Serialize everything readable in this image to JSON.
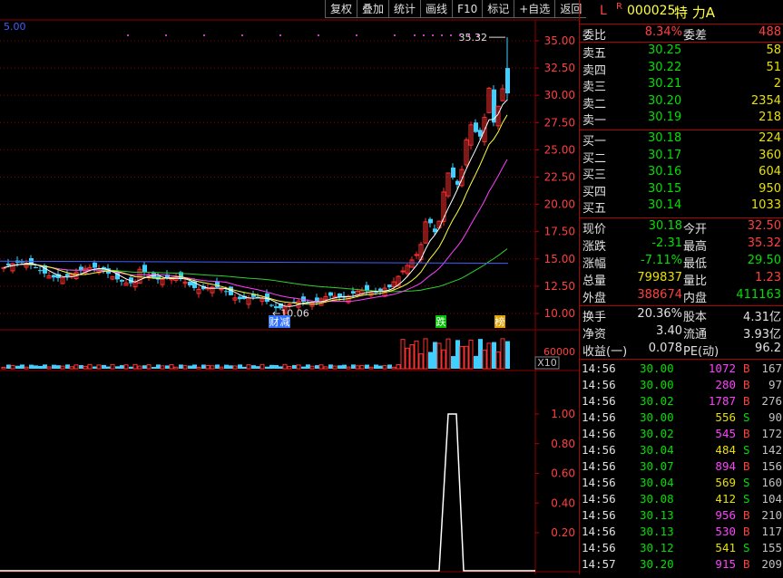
{
  "toolbar": [
    "复权",
    "叠加",
    "统计",
    "画线",
    "F10",
    "标记",
    "+自选",
    "返回"
  ],
  "chart": {
    "ma_label": "5.00",
    "peak_label": "35.32",
    "low_label": "10.06",
    "price_ticks": [
      "35.00",
      "32.50",
      "30.00",
      "27.50",
      "25.00",
      "22.50",
      "20.00",
      "17.50",
      "15.00",
      "12.50",
      "10.00"
    ],
    "badges": [
      {
        "text": "财",
        "color": "#3070ff"
      },
      {
        "text": "减",
        "color": "#3070ff"
      },
      {
        "text": "跌",
        "color": "#00c000"
      },
      {
        "text": "榜",
        "color": "#e0a000"
      }
    ],
    "vol_tick": "60000",
    "vol_unit": "X10",
    "ind_ticks": [
      "1.00",
      "0.80",
      "0.60",
      "0.40",
      "0.20"
    ],
    "colors": {
      "up": "#ff3030",
      "down": "#40d0ff",
      "ma5": "#ffffff",
      "ma10": "#ffff40",
      "ma20": "#ff40ff",
      "ma60": "#30d030",
      "grid": "#8b0000"
    }
  },
  "quote": {
    "header_l": "L",
    "header_r": "R",
    "code": "000025",
    "name": "特 力A",
    "weibi_label": "委比",
    "weibi": "8.34%",
    "weicha_label": "委差",
    "weicha": "488",
    "asks": [
      {
        "label": "卖五",
        "price": "30.25",
        "vol": "58"
      },
      {
        "label": "卖四",
        "price": "30.22",
        "vol": "51"
      },
      {
        "label": "卖三",
        "price": "30.21",
        "vol": "2"
      },
      {
        "label": "卖二",
        "price": "30.20",
        "vol": "2354"
      },
      {
        "label": "卖一",
        "price": "30.19",
        "vol": "218"
      }
    ],
    "bids": [
      {
        "label": "买一",
        "price": "30.18",
        "vol": "224"
      },
      {
        "label": "买二",
        "price": "30.17",
        "vol": "360"
      },
      {
        "label": "买三",
        "price": "30.16",
        "vol": "604"
      },
      {
        "label": "买四",
        "price": "30.15",
        "vol": "950"
      },
      {
        "label": "买五",
        "price": "30.14",
        "vol": "1033"
      }
    ],
    "stats": [
      {
        "l1": "现价",
        "v1": "30.18",
        "c1": "g",
        "l2": "今开",
        "v2": "32.50",
        "c2": "r"
      },
      {
        "l1": "涨跌",
        "v1": "-2.31",
        "c1": "g",
        "l2": "最高",
        "v2": "35.32",
        "c2": "r"
      },
      {
        "l1": "涨幅",
        "v1": "-7.11%",
        "c1": "g",
        "l2": "最低",
        "v2": "29.50",
        "c2": "g"
      },
      {
        "l1": "总量",
        "v1": "799837",
        "c1": "y",
        "l2": "量比",
        "v2": "1.23",
        "c2": "r"
      },
      {
        "l1": "外盘",
        "v1": "388674",
        "c1": "r",
        "l2": "内盘",
        "v2": "411163",
        "c2": "g"
      }
    ],
    "fund": [
      {
        "l1": "换手",
        "v1": "20.36%",
        "l2": "股本",
        "v2": "4.31亿"
      },
      {
        "l1": "净资",
        "v1": "3.40",
        "l2": "流通",
        "v2": "3.93亿"
      },
      {
        "l1": "收益(一)",
        "v1": "0.078",
        "l2": "PE(动)",
        "v2": "96.2"
      }
    ],
    "ticks": [
      {
        "time": "14:56",
        "price": "30.00",
        "vol": "1072",
        "dir": "B",
        "cnt": "167"
      },
      {
        "time": "14:56",
        "price": "30.00",
        "vol": "280",
        "dir": "B",
        "cnt": "97"
      },
      {
        "time": "14:56",
        "price": "30.02",
        "vol": "1787",
        "dir": "B",
        "cnt": "276"
      },
      {
        "time": "14:56",
        "price": "30.00",
        "vol": "556",
        "dir": "S",
        "cnt": "90"
      },
      {
        "time": "14:56",
        "price": "30.02",
        "vol": "545",
        "dir": "B",
        "cnt": "172"
      },
      {
        "time": "14:56",
        "price": "30.04",
        "vol": "484",
        "dir": "S",
        "cnt": "142"
      },
      {
        "time": "14:56",
        "price": "30.07",
        "vol": "894",
        "dir": "B",
        "cnt": "156"
      },
      {
        "time": "14:56",
        "price": "30.04",
        "vol": "569",
        "dir": "S",
        "cnt": "160"
      },
      {
        "time": "14:56",
        "price": "30.08",
        "vol": "412",
        "dir": "S",
        "cnt": "104"
      },
      {
        "time": "14:56",
        "price": "30.13",
        "vol": "956",
        "dir": "B",
        "cnt": "210"
      },
      {
        "time": "14:56",
        "price": "30.13",
        "vol": "530",
        "dir": "B",
        "cnt": "117"
      },
      {
        "time": "14:56",
        "price": "30.12",
        "vol": "541",
        "dir": "S",
        "cnt": "155"
      },
      {
        "time": "14:57",
        "price": "30.20",
        "vol": "915",
        "dir": "B",
        "cnt": "209"
      }
    ]
  }
}
